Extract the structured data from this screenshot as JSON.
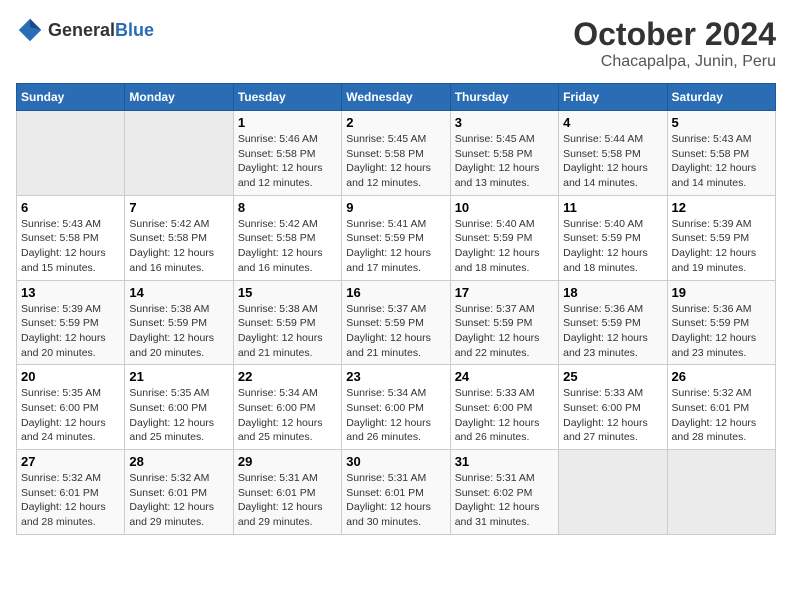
{
  "logo": {
    "text_general": "General",
    "text_blue": "Blue"
  },
  "title": "October 2024",
  "subtitle": "Chacapalpa, Junin, Peru",
  "days_of_week": [
    "Sunday",
    "Monday",
    "Tuesday",
    "Wednesday",
    "Thursday",
    "Friday",
    "Saturday"
  ],
  "weeks": [
    [
      {
        "day": "",
        "sunrise": "",
        "sunset": "",
        "daylight": "",
        "empty": true
      },
      {
        "day": "",
        "sunrise": "",
        "sunset": "",
        "daylight": "",
        "empty": true
      },
      {
        "day": "1",
        "sunrise": "Sunrise: 5:46 AM",
        "sunset": "Sunset: 5:58 PM",
        "daylight": "Daylight: 12 hours and 12 minutes."
      },
      {
        "day": "2",
        "sunrise": "Sunrise: 5:45 AM",
        "sunset": "Sunset: 5:58 PM",
        "daylight": "Daylight: 12 hours and 12 minutes."
      },
      {
        "day": "3",
        "sunrise": "Sunrise: 5:45 AM",
        "sunset": "Sunset: 5:58 PM",
        "daylight": "Daylight: 12 hours and 13 minutes."
      },
      {
        "day": "4",
        "sunrise": "Sunrise: 5:44 AM",
        "sunset": "Sunset: 5:58 PM",
        "daylight": "Daylight: 12 hours and 14 minutes."
      },
      {
        "day": "5",
        "sunrise": "Sunrise: 5:43 AM",
        "sunset": "Sunset: 5:58 PM",
        "daylight": "Daylight: 12 hours and 14 minutes."
      }
    ],
    [
      {
        "day": "6",
        "sunrise": "Sunrise: 5:43 AM",
        "sunset": "Sunset: 5:58 PM",
        "daylight": "Daylight: 12 hours and 15 minutes."
      },
      {
        "day": "7",
        "sunrise": "Sunrise: 5:42 AM",
        "sunset": "Sunset: 5:58 PM",
        "daylight": "Daylight: 12 hours and 16 minutes."
      },
      {
        "day": "8",
        "sunrise": "Sunrise: 5:42 AM",
        "sunset": "Sunset: 5:58 PM",
        "daylight": "Daylight: 12 hours and 16 minutes."
      },
      {
        "day": "9",
        "sunrise": "Sunrise: 5:41 AM",
        "sunset": "Sunset: 5:59 PM",
        "daylight": "Daylight: 12 hours and 17 minutes."
      },
      {
        "day": "10",
        "sunrise": "Sunrise: 5:40 AM",
        "sunset": "Sunset: 5:59 PM",
        "daylight": "Daylight: 12 hours and 18 minutes."
      },
      {
        "day": "11",
        "sunrise": "Sunrise: 5:40 AM",
        "sunset": "Sunset: 5:59 PM",
        "daylight": "Daylight: 12 hours and 18 minutes."
      },
      {
        "day": "12",
        "sunrise": "Sunrise: 5:39 AM",
        "sunset": "Sunset: 5:59 PM",
        "daylight": "Daylight: 12 hours and 19 minutes."
      }
    ],
    [
      {
        "day": "13",
        "sunrise": "Sunrise: 5:39 AM",
        "sunset": "Sunset: 5:59 PM",
        "daylight": "Daylight: 12 hours and 20 minutes."
      },
      {
        "day": "14",
        "sunrise": "Sunrise: 5:38 AM",
        "sunset": "Sunset: 5:59 PM",
        "daylight": "Daylight: 12 hours and 20 minutes."
      },
      {
        "day": "15",
        "sunrise": "Sunrise: 5:38 AM",
        "sunset": "Sunset: 5:59 PM",
        "daylight": "Daylight: 12 hours and 21 minutes."
      },
      {
        "day": "16",
        "sunrise": "Sunrise: 5:37 AM",
        "sunset": "Sunset: 5:59 PM",
        "daylight": "Daylight: 12 hours and 21 minutes."
      },
      {
        "day": "17",
        "sunrise": "Sunrise: 5:37 AM",
        "sunset": "Sunset: 5:59 PM",
        "daylight": "Daylight: 12 hours and 22 minutes."
      },
      {
        "day": "18",
        "sunrise": "Sunrise: 5:36 AM",
        "sunset": "Sunset: 5:59 PM",
        "daylight": "Daylight: 12 hours and 23 minutes."
      },
      {
        "day": "19",
        "sunrise": "Sunrise: 5:36 AM",
        "sunset": "Sunset: 5:59 PM",
        "daylight": "Daylight: 12 hours and 23 minutes."
      }
    ],
    [
      {
        "day": "20",
        "sunrise": "Sunrise: 5:35 AM",
        "sunset": "Sunset: 6:00 PM",
        "daylight": "Daylight: 12 hours and 24 minutes."
      },
      {
        "day": "21",
        "sunrise": "Sunrise: 5:35 AM",
        "sunset": "Sunset: 6:00 PM",
        "daylight": "Daylight: 12 hours and 25 minutes."
      },
      {
        "day": "22",
        "sunrise": "Sunrise: 5:34 AM",
        "sunset": "Sunset: 6:00 PM",
        "daylight": "Daylight: 12 hours and 25 minutes."
      },
      {
        "day": "23",
        "sunrise": "Sunrise: 5:34 AM",
        "sunset": "Sunset: 6:00 PM",
        "daylight": "Daylight: 12 hours and 26 minutes."
      },
      {
        "day": "24",
        "sunrise": "Sunrise: 5:33 AM",
        "sunset": "Sunset: 6:00 PM",
        "daylight": "Daylight: 12 hours and 26 minutes."
      },
      {
        "day": "25",
        "sunrise": "Sunrise: 5:33 AM",
        "sunset": "Sunset: 6:00 PM",
        "daylight": "Daylight: 12 hours and 27 minutes."
      },
      {
        "day": "26",
        "sunrise": "Sunrise: 5:32 AM",
        "sunset": "Sunset: 6:01 PM",
        "daylight": "Daylight: 12 hours and 28 minutes."
      }
    ],
    [
      {
        "day": "27",
        "sunrise": "Sunrise: 5:32 AM",
        "sunset": "Sunset: 6:01 PM",
        "daylight": "Daylight: 12 hours and 28 minutes."
      },
      {
        "day": "28",
        "sunrise": "Sunrise: 5:32 AM",
        "sunset": "Sunset: 6:01 PM",
        "daylight": "Daylight: 12 hours and 29 minutes."
      },
      {
        "day": "29",
        "sunrise": "Sunrise: 5:31 AM",
        "sunset": "Sunset: 6:01 PM",
        "daylight": "Daylight: 12 hours and 29 minutes."
      },
      {
        "day": "30",
        "sunrise": "Sunrise: 5:31 AM",
        "sunset": "Sunset: 6:01 PM",
        "daylight": "Daylight: 12 hours and 30 minutes."
      },
      {
        "day": "31",
        "sunrise": "Sunrise: 5:31 AM",
        "sunset": "Sunset: 6:02 PM",
        "daylight": "Daylight: 12 hours and 31 minutes."
      },
      {
        "day": "",
        "sunrise": "",
        "sunset": "",
        "daylight": "",
        "empty": true
      },
      {
        "day": "",
        "sunrise": "",
        "sunset": "",
        "daylight": "",
        "empty": true
      }
    ]
  ]
}
